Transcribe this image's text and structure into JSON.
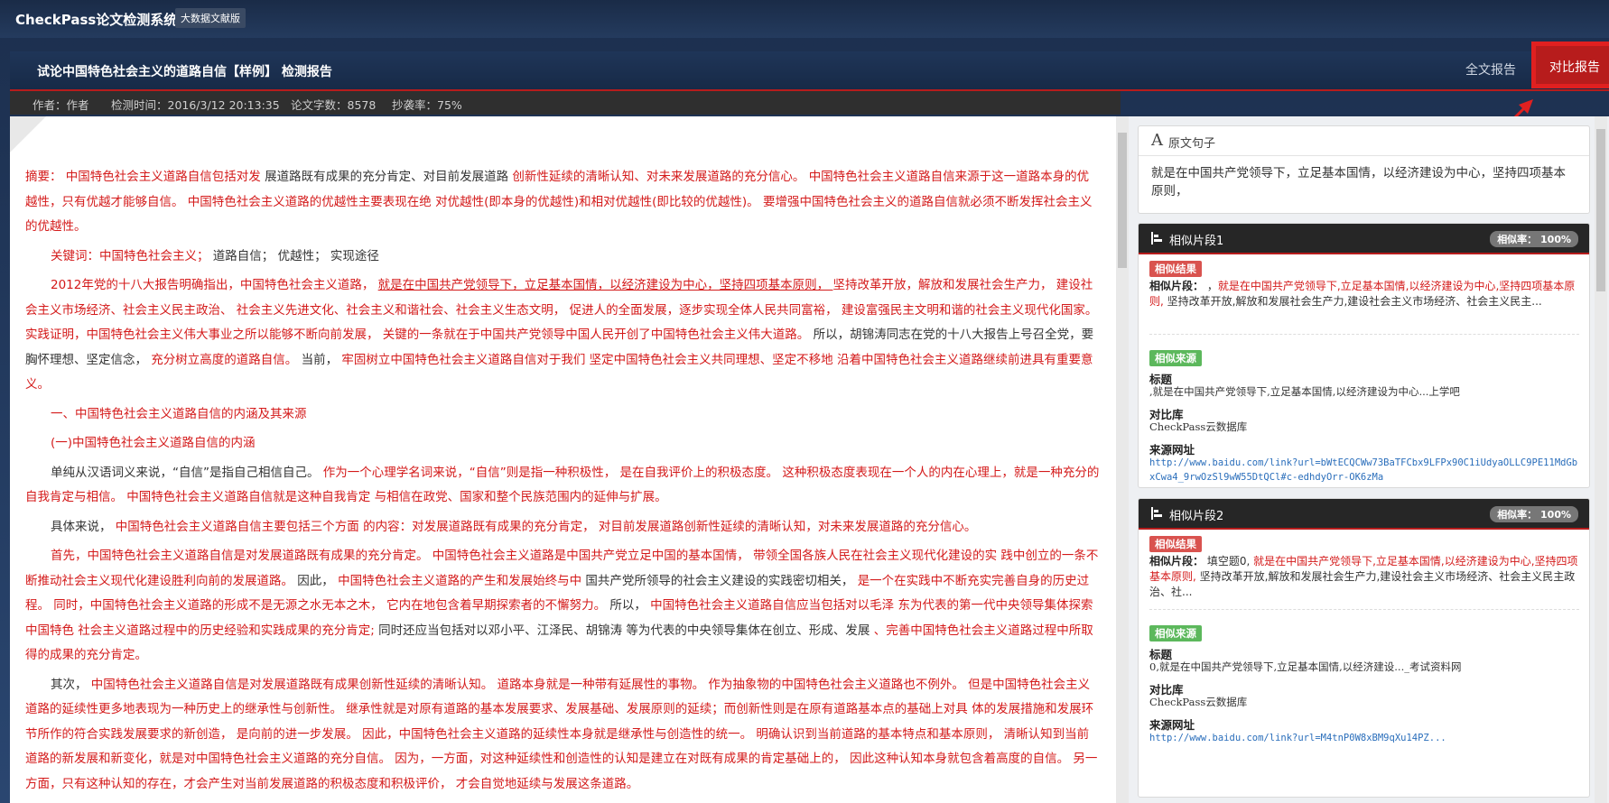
{
  "header": {
    "app_title": "CheckPass论文检测系统",
    "edition_badge": "大数据文献版"
  },
  "report": {
    "title": "试论中国特色社会主义的道路自信【样例】 检测报告",
    "tab_full": "全文报告",
    "tab_compare": "对比报告",
    "meta": {
      "author": "作者：作者",
      "time": "检测时间：2016/3/12 20:13:35",
      "words": "论文字数：8578",
      "rate": "抄袭率：75%"
    }
  },
  "document": {
    "paragraphs": [
      {
        "indent": false,
        "segments": [
          {
            "t": "摘要： ",
            "red": true
          },
          {
            "t": "中国特色社会主义道路自信包括对发 ",
            "red": true
          },
          {
            "t": "展道路既有成果的充分肯定、对目前发展道路 ",
            "red": false
          },
          {
            "t": "创新性延续的清晰认知、对未来发展道路的充分信心。 ",
            "red": true
          },
          {
            "t": "中国特色社会主义道路自信来源于这一道路本身的优越性，只有优越才能够自信。 ",
            "red": true
          },
          {
            "t": "中国特色社会主义道路的优越性主要表现在绝 对优越性(即本身的优越性)和相对优越性(即比较的优越性)。 ",
            "red": true
          },
          {
            "t": "要增强中国特色社会主义的道路自信就必须不断发挥社会主义的优越性。",
            "red": true
          }
        ]
      },
      {
        "indent": true,
        "segments": [
          {
            "t": "关键词：中国特色社会主义； ",
            "red": true
          },
          {
            "t": "道路自信； 优越性； 实现途径",
            "red": false
          }
        ]
      },
      {
        "indent": true,
        "segments": [
          {
            "t": "2012年党的十八大报告明确指出，中国特色社会主义道路， ",
            "red": true
          },
          {
            "t": "就是在中国共产党领导下，立足基本国情，以经济建设为中心，坚持四项基本原则， ",
            "red": true,
            "u": true
          },
          {
            "t": "坚持改革开放，解放和发展社会生产力， 建设社会主义市场经济、社会主义民主政治、 社会主义先进文化、社会主义和谐社会、社会主义生态文明， 促进人的全面发展，逐步实现全体人民共同富裕， 建设富强民主文明和谐的社会主义现代化国家。 实践证明，中国特色社会主义伟大事业之所以能够不断向前发展， 关键的一条就在于中国共产党领导中国人民开创了中国特色社会主义伟大道路。 ",
            "red": true
          },
          {
            "t": "所以，胡锦涛同志在党的十八大报告上号召全党，要胸怀理想、坚定信念， ",
            "red": false
          },
          {
            "t": "充分树立高度的道路自信。 ",
            "red": true
          },
          {
            "t": "当前， ",
            "red": false
          },
          {
            "t": "牢固树立中国特色社会主义道路自信对于我们 坚定中国特色社会主义共同理想、坚定不移地 沿着中国特色社会主义道路继续前进具有重要意义。",
            "red": true
          }
        ]
      },
      {
        "indent": true,
        "segments": [
          {
            "t": "一、中国特色社会主义道路自信的内涵及其来源",
            "red": true
          }
        ]
      },
      {
        "indent": true,
        "segments": [
          {
            "t": "(一)中国特色社会主义道路自信的内涵",
            "red": true
          }
        ]
      },
      {
        "indent": true,
        "segments": [
          {
            "t": "单纯从汉语词义来说，“自信”是指自己相信自己。 ",
            "red": false
          },
          {
            "t": "作为一个心理学名词来说，“自信”则是指一种积极性， 是在自我评价上的积极态度。 这种积极态度表现在一个人的内在心理上，就是一种充分的自我肯定与相信。 中国特色社会主义道路自信就是这种自我肯定 与相信在政党、国家和整个民族范围内的延伸与扩展。",
            "red": true
          }
        ]
      },
      {
        "indent": true,
        "segments": [
          {
            "t": "具体来说， ",
            "red": false
          },
          {
            "t": "中国特色社会主义道路自信主要包括三个方面 的内容：对发展道路既有成果的充分肯定， 对目前发展道路创新性延续的清晰认知，对未来发展道路的充分信心。",
            "red": true
          }
        ]
      },
      {
        "indent": true,
        "segments": [
          {
            "t": "首先，中国特色社会主义道路自信是对发展道路既有成果的充分肯定。 中国特色社会主义道路是中国共产党立足中国的基本国情， 带领全国各族人民在社会主义现代化建设的实 践中创立的一条不断推动社会主义现代化建设胜利向前的发展道路。 ",
            "red": true
          },
          {
            "t": "因此， ",
            "red": false
          },
          {
            "t": "中国特色社会主义道路的产生和发展始终与中 ",
            "red": true
          },
          {
            "t": "国共产党所领导的社会主义建设的实践密切相关， ",
            "red": false
          },
          {
            "t": "是一个在实践中不断充实完善自身的历史过程。 同时，中国特色社会主义道路的形成不是无源之水无本之木， 它内在地包含着早期探索者的不懈努力。 ",
            "red": true
          },
          {
            "t": "所以， ",
            "red": false
          },
          {
            "t": "中国特色社会主义道路自信应当包括对以毛泽 东为代表的第一代中央领导集体探索中国特色 社会主义道路过程中的历史经验和实践成果的充分肯定; ",
            "red": true
          },
          {
            "t": "同时还应当包括对以邓小平、江泽民、胡锦涛 等为代表的中央领导集体在创立、形成、发展 ",
            "red": false
          },
          {
            "t": "、完善中国特色社会主义道路过程中所取得的成果的充分肯定。",
            "red": true
          }
        ]
      },
      {
        "indent": true,
        "segments": [
          {
            "t": "其次， ",
            "red": false
          },
          {
            "t": "中国特色社会主义道路自信是对发展道路既有成果创新性延续的清晰认知。 道路本身就是一种带有延展性的事物。 作为抽象物的中国特色社会主义道路也不例外。 但是中国特色社会主义道路的延续性更多地表现为一种历史上的继承性与创新性。 继承性就是对原有道路的基本发展要求、发展基础、发展原则的延续；而创新性则是在原有道路基本点的基础上对具 体的发展措施和发展环节所作的符合实践发展要求的新创造， 是向前的进一步发展。 因此，中国特色社会主义道路的延续性本身就是继承性与创造性的统一。 明确认识到当前道路的基本特点和基本原则， 清晰认知到当前道路的新发展和新变化，就是对中国特色社会主义道路的充分自信。 因为，一方面，对这种延续性和创造性的认知是建立在对既有成果的肯定基础上的， 因此这种认知本身就包含着高度的自信。 另一方面，只有这种认知的存在，才会产生对当前发展道路的积极态度和积极评价， 才会自觉地延续与发展这条道路。",
            "red": true
          }
        ]
      }
    ]
  },
  "original": {
    "title": "原文句子",
    "text": "就是在中国共产党领导下，立足基本国情，以经济建设为中心，坚持四项基本原则，"
  },
  "fragments": [
    {
      "title": "相似片段1",
      "rate": "相似率： 100%",
      "result_badge": "相似结果",
      "fragment_label": "相似片段：",
      "fragment_prefix": " ，",
      "fragment_red": "就是在中国共产党领导下,立足基本国情,以经济建设为中心,坚持四项基本原则,",
      "fragment_rest": " 坚持改革开放,解放和发展社会生产力,建设社会主义市场经济、社会主义民主...",
      "source_badge": "相似来源",
      "title_label": "标题",
      "title_value": ",就是在中国共产党领导下,立足基本国情,以经济建设为中心...上学吧",
      "db_label": "对比库",
      "db_value": "CheckPass云数据库",
      "url_label": "来源网址",
      "url_value": "http://www.baidu.com/link?url=bWtECQCWw73BaTFCbx9LFPx90C1iUdyaOLLC9PE11MdGbxCwa4_9rwOzSl9wW55DtQCl#c-edhdyOrr-OK6zMa"
    },
    {
      "title": "相似片段2",
      "rate": "相似率： 100%",
      "result_badge": "相似结果",
      "fragment_label": "相似片段：",
      "fragment_prefix": " 填空题0, ",
      "fragment_red": "就是在中国共产党领导下,立足基本国情,以经济建设为中心,坚持四项基本原则,",
      "fragment_rest": " 坚持改革开放,解放和发展社会生产力,建设社会主义市场经济、社会主义民主政治、社...",
      "source_badge": "相似来源",
      "title_label": "标题",
      "title_value": "0,就是在中国共产党领导下,立足基本国情,以经济建设..._考试资料网",
      "db_label": "对比库",
      "db_value": "CheckPass云数据库",
      "url_label": "来源网址",
      "url_value": "http://www.baidu.com/link?url=M4tnP0W8xBM9qXu14PZ..."
    }
  ],
  "colors": {
    "accent_red": "#d41a1a",
    "header_navy": "#1f3558"
  }
}
